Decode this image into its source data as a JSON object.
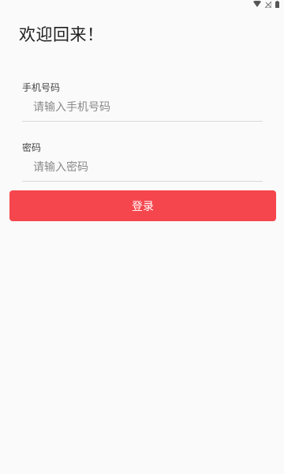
{
  "status_bar": {
    "icons": [
      "wifi-icon",
      "signal-off-icon",
      "battery-icon"
    ]
  },
  "header": {
    "title": "欢迎回来！"
  },
  "form": {
    "phone": {
      "label": "手机号码",
      "placeholder": "请输入手机号码",
      "value": ""
    },
    "password": {
      "label": "密码",
      "placeholder": "请输入密码",
      "value": ""
    },
    "login_label": "登录"
  },
  "colors": {
    "accent": "#f6464d",
    "background": "#fafafa",
    "underline": "#d9d9d9"
  }
}
